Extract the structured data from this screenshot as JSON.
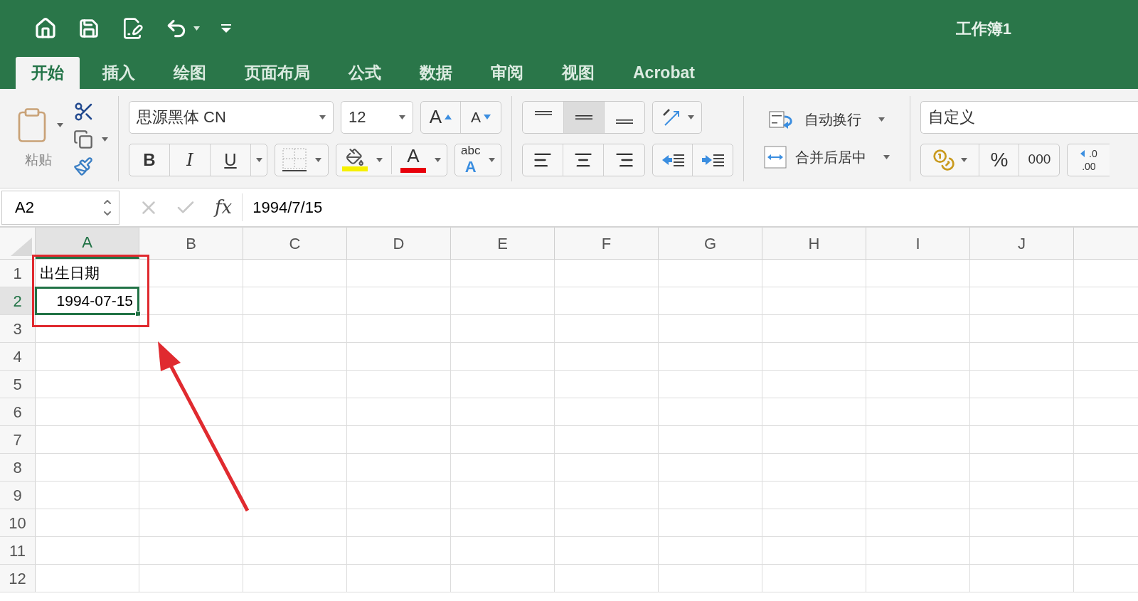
{
  "window": {
    "title": "工作簿1"
  },
  "tabs": [
    {
      "label": "开始",
      "selected": true
    },
    {
      "label": "插入",
      "selected": false
    },
    {
      "label": "绘图",
      "selected": false
    },
    {
      "label": "页面布局",
      "selected": false
    },
    {
      "label": "公式",
      "selected": false
    },
    {
      "label": "数据",
      "selected": false
    },
    {
      "label": "审阅",
      "selected": false
    },
    {
      "label": "视图",
      "selected": false
    },
    {
      "label": "Acrobat",
      "selected": false
    }
  ],
  "ribbon": {
    "paste_label": "粘贴",
    "font_name": "思源黑体 CN",
    "font_size": "12",
    "grow_font": "A",
    "shrink_font": "A",
    "bold": "B",
    "italic": "I",
    "underline": "U",
    "font_color_letter": "A",
    "phonetic_top": "abc",
    "phonetic_bottom": "A",
    "vertical_align": [
      {
        "kind": "top",
        "selected": false
      },
      {
        "kind": "middle",
        "selected": true
      },
      {
        "kind": "bottom",
        "selected": false
      }
    ],
    "wrap_text": "自动换行",
    "merge_center": "合并后居中",
    "number_format": "自定义",
    "percent": "%",
    "comma": "000",
    "decimal_top": ".0",
    "decimal_bottom": ".00"
  },
  "formula_bar": {
    "name_box": "A2",
    "fx": "fx",
    "value": "1994/7/15"
  },
  "sheet": {
    "columns": [
      {
        "label": "A",
        "selected": true
      },
      {
        "label": "B",
        "selected": false
      },
      {
        "label": "C",
        "selected": false
      },
      {
        "label": "D",
        "selected": false
      },
      {
        "label": "E",
        "selected": false
      },
      {
        "label": "F",
        "selected": false
      },
      {
        "label": "G",
        "selected": false
      },
      {
        "label": "H",
        "selected": false
      },
      {
        "label": "I",
        "selected": false
      },
      {
        "label": "J",
        "selected": false
      }
    ],
    "rows": [
      {
        "label": "1",
        "selected": false,
        "cells": [
          {
            "text": "出生日期",
            "selected": false,
            "kind": "text"
          }
        ]
      },
      {
        "label": "2",
        "selected": true,
        "cells": [
          {
            "text": "1994-07-15",
            "selected": true,
            "kind": "number"
          }
        ]
      },
      {
        "label": "3",
        "selected": false
      },
      {
        "label": "4",
        "selected": false
      },
      {
        "label": "5",
        "selected": false
      },
      {
        "label": "6",
        "selected": false
      },
      {
        "label": "7",
        "selected": false
      },
      {
        "label": "8",
        "selected": false
      },
      {
        "label": "9",
        "selected": false
      },
      {
        "label": "10",
        "selected": false
      },
      {
        "label": "11",
        "selected": false
      },
      {
        "label": "12",
        "selected": false
      }
    ]
  },
  "annotation": {
    "highlight_box": true,
    "arrow": true
  }
}
